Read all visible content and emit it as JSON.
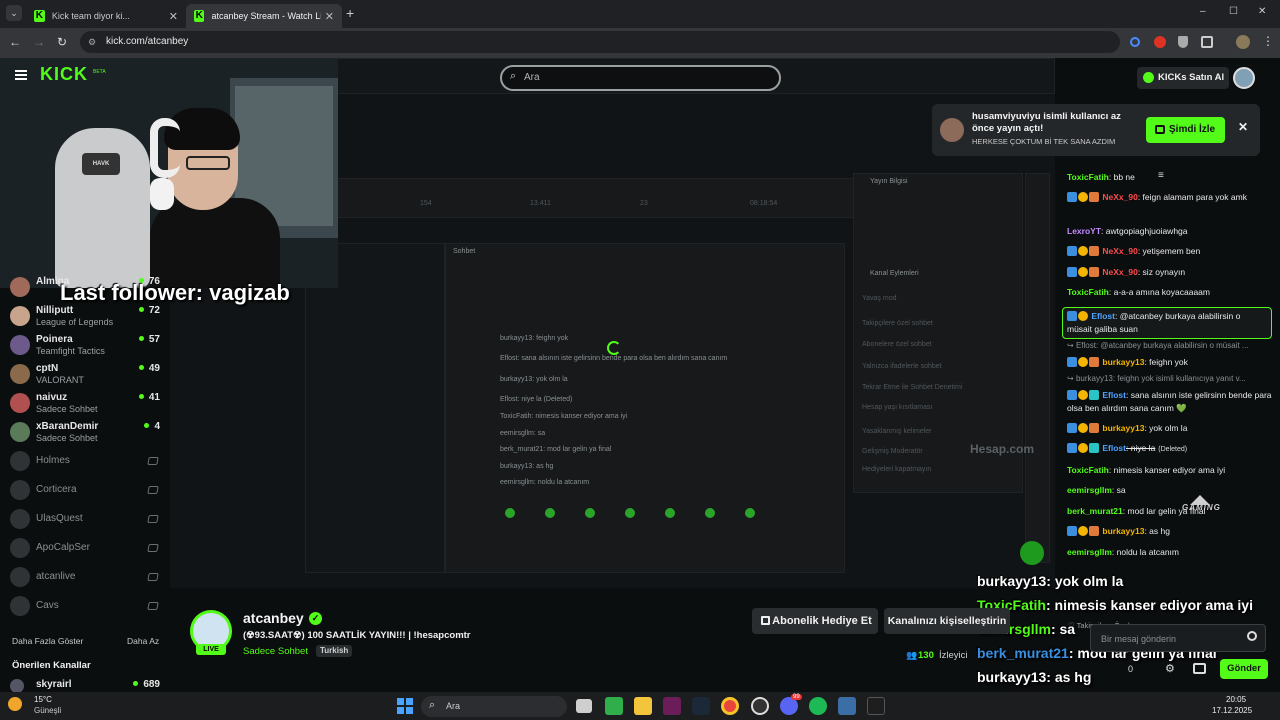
{
  "browser": {
    "tabs": [
      {
        "title": "Kick team diyor ki...",
        "active": false
      },
      {
        "title": "atcanbey Stream - Watch Live o...",
        "active": true
      }
    ],
    "new_tab": "+",
    "url": "kick.com/atcanbey",
    "window_controls": [
      "–",
      "☐",
      "✕"
    ]
  },
  "header": {
    "logo": "KICK",
    "logo_beta": "BETA",
    "search_placeholder": "Ara",
    "kicks_button": "KICKs Satın Al"
  },
  "notification": {
    "title": "husamviyuviyu isimli kullanıcı az önce yayın açtı!",
    "subtitle": "HERKESE ÇOKTUM Bİ TEK SANA AZDIM",
    "button": "Şimdi İzle",
    "close": "✕"
  },
  "sidebar": {
    "channels": [
      {
        "name": "Almina",
        "category": "",
        "viewers": "76",
        "online": true
      },
      {
        "name": "Nilliputt",
        "category": "League of Legends",
        "viewers": "72",
        "online": true
      },
      {
        "name": "Poinera",
        "category": "Teamfight Tactics",
        "viewers": "57",
        "online": true
      },
      {
        "name": "cptN",
        "category": "VALORANT",
        "viewers": "49",
        "online": true
      },
      {
        "name": "naivuz",
        "category": "Sadece Sohbet",
        "viewers": "41",
        "online": true
      },
      {
        "name": "xBaranDemir",
        "category": "Sadece Sohbet",
        "viewers": "4",
        "online": true
      },
      {
        "name": "Holmes",
        "online": false
      },
      {
        "name": "Corticera",
        "online": false
      },
      {
        "name": "UlasQuest",
        "online": false
      },
      {
        "name": "ApoCalpSer",
        "online": false
      },
      {
        "name": "atcanlive",
        "online": false
      },
      {
        "name": "Cavs",
        "online": false
      }
    ],
    "show_more": "Daha Fazla Göster",
    "show_less": "Daha Az",
    "recommended_title": "Önerilen Kanallar",
    "recommended": [
      {
        "name": "skyrairl",
        "viewers": "689"
      }
    ]
  },
  "stream_overlay": {
    "follower_text": "Last follower: vagizab",
    "chat_lines": [
      {
        "user": "burkayy13",
        "text": ": yok olm la"
      },
      {
        "user": "ToxicFatih",
        "text": ": nimesis kanser ediyor ama iyi"
      },
      {
        "user": "eemirsgllm",
        "text": ": sa"
      },
      {
        "user": "berk_murat21",
        "text": ": mod lar gelin ya final"
      },
      {
        "user": "burkayy13",
        "text": ": as hg"
      },
      {
        "user": "eemirsgllm",
        "text": ": noldu la atcanim"
      }
    ],
    "brand": "GAMING",
    "watermark": "Hesap.com"
  },
  "channel": {
    "name": "atcanbey",
    "title": "(☢93.SAAT☢) 100 SAATLİK YAYIN!!! | !hesapcomtr",
    "category": "Sadece Sohbet",
    "tag": "Turkish",
    "live_badge": "LIVE",
    "gift_button": "Abonelik Hediye Et",
    "customize_button": "Kanalınızı kişiselleştirin",
    "viewer_count": "130",
    "viewer_label": "İzleyici"
  },
  "chat": {
    "messages": [
      {
        "user": "ToxicFatih",
        "color": "#53fc18",
        "text": ": bb ne"
      },
      {
        "user": "NeXx_90",
        "color": "#ff4a4a",
        "text": ": feign alamam para yok amk",
        "badges": [
          "#3a8fe0",
          "#f5b400",
          "#e07a3a"
        ]
      },
      {
        "user": "LexroYT",
        "color": "#c58bff",
        "text": ": awtgopiaghjuoiawhga"
      },
      {
        "user": "NeXx_90",
        "color": "#ff4a4a",
        "text": ": yetişemem ben",
        "badges": [
          "#3a8fe0",
          "#f5b400",
          "#e07a3a"
        ]
      },
      {
        "user": "NeXx_90",
        "color": "#ff4a4a",
        "text": ": siz oynayın",
        "badges": [
          "#3a8fe0",
          "#f5b400",
          "#e07a3a"
        ]
      },
      {
        "user": "ToxicFatih",
        "color": "#53fc18",
        "text": ": a-a-a amına koyacaaaam"
      },
      {
        "user": "Eflost",
        "color": "#4fa3ff",
        "text": ": @atcanbey burkaya alabilirsin o müsait galiba suan",
        "highlight": true,
        "badges": [
          "#3a8fe0",
          "#f5b400"
        ]
      },
      {
        "reply": "Eflost: @atcanbey burkaya alabilirsin o müsait ..."
      },
      {
        "user": "burkayy13",
        "color": "#f5b400",
        "text": ": feighn yok",
        "badges": [
          "#3a8fe0",
          "#f5b400",
          "#e07a3a"
        ]
      },
      {
        "reply": "burkayy13: feighn yok isimli kullanıcıya yanıt v..."
      },
      {
        "user": "Eflost",
        "color": "#4fa3ff",
        "text": ": sana alsının iste gelirsinn bende para olsa ben alırdım sana canım 💚",
        "badges": [
          "#3a8fe0",
          "#f5b400",
          "#2bc4c4"
        ]
      },
      {
        "user": "burkayy13",
        "color": "#f5b400",
        "text": ": yok olm la",
        "badges": [
          "#3a8fe0",
          "#f5b400",
          "#e07a3a"
        ]
      },
      {
        "user": "Eflost",
        "color": "#4fa3ff",
        "text": ": niye la",
        "deleted": "(Deleted)",
        "badges": [
          "#3a8fe0",
          "#f5b400",
          "#2bc4c4"
        ]
      },
      {
        "user": "ToxicFatih",
        "color": "#53fc18",
        "text": ": nimesis kanser ediyor ama iyi"
      },
      {
        "user": "eemirsgllm",
        "color": "#53fc18",
        "text": ": sa"
      },
      {
        "user": "berk_murat21",
        "color": "#53fc18",
        "text": ": mod lar gelin ya final"
      },
      {
        "user": "burkayy13",
        "color": "#f5b400",
        "text": ": as hg",
        "badges": [
          "#3a8fe0",
          "#f5b400",
          "#e07a3a"
        ]
      },
      {
        "user": "eemirsgllm",
        "color": "#53fc18",
        "text": ": noldu la atcanım"
      }
    ],
    "followers_only": "Takipçilere Özel",
    "input_placeholder": "Bir mesaj gönderin",
    "counter": "0",
    "send_button": "Gönder"
  },
  "taskbar": {
    "weather_temp": "15°C",
    "weather_label": "Güneşli",
    "search_placeholder": "Ara",
    "time": "20:05",
    "date": "17.12.2025",
    "discord_badge": "99"
  }
}
